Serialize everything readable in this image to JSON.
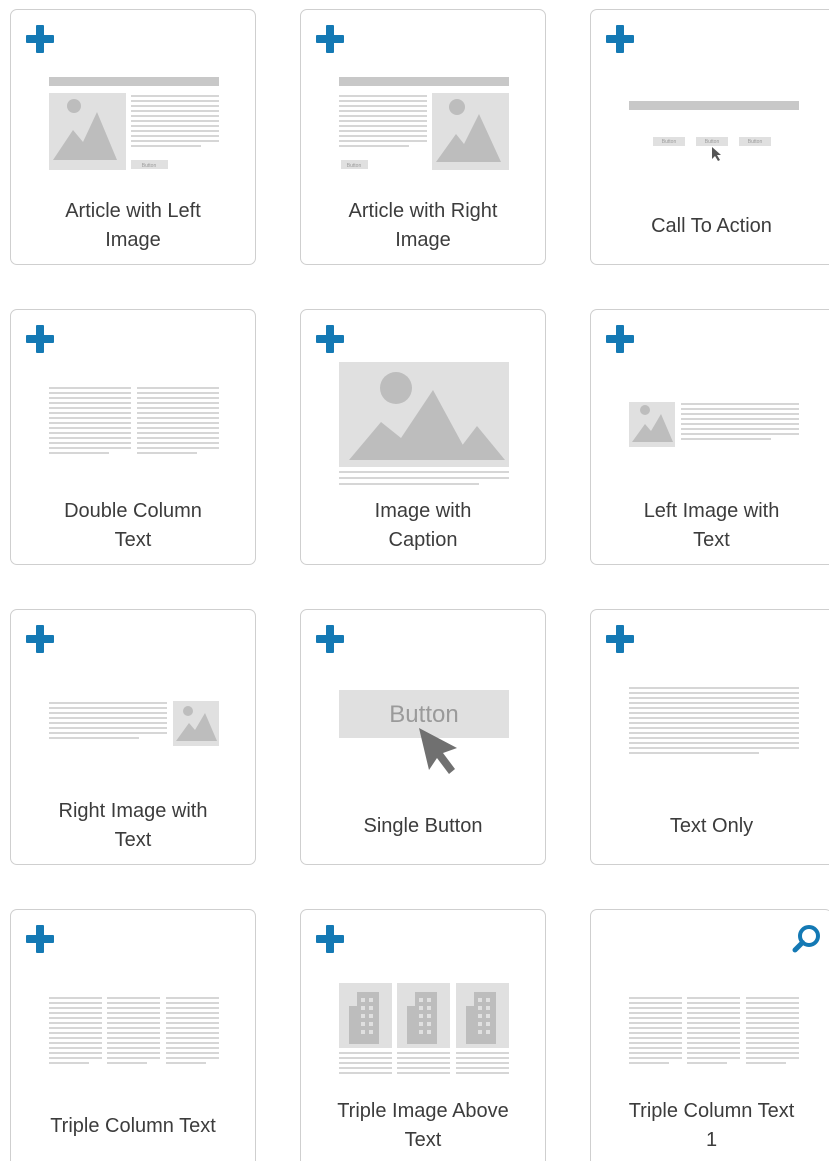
{
  "colors": {
    "accent": "#1479b4",
    "border": "#cfcfcf",
    "thumb_gray": "#c8c8c8",
    "text": "#3c3c3c"
  },
  "templates": [
    {
      "label": "Article with Left Image",
      "line1": "Article with Left",
      "line2": "Image",
      "icon": "plus-icon",
      "thumb_button": "Button"
    },
    {
      "label": "Article with Right Image",
      "line1": "Article with Right",
      "line2": "Image",
      "icon": "plus-icon",
      "thumb_button": "Button"
    },
    {
      "label": "Call To Action",
      "line1": "Call To Action",
      "line2": "",
      "icon": "plus-icon",
      "thumb_button": "Button"
    },
    {
      "label": "Double Column Text",
      "line1": "Double Column",
      "line2": "Text",
      "icon": "plus-icon"
    },
    {
      "label": "Image with Caption",
      "line1": "Image with",
      "line2": "Caption",
      "icon": "plus-icon"
    },
    {
      "label": "Left Image with Text",
      "line1": "Left Image with",
      "line2": "Text",
      "icon": "plus-icon"
    },
    {
      "label": "Right Image with Text",
      "line1": "Right Image with",
      "line2": "Text",
      "icon": "plus-icon"
    },
    {
      "label": "Single Button",
      "line1": "Single Button",
      "line2": "",
      "icon": "plus-icon",
      "thumb_button": "Button"
    },
    {
      "label": "Text Only",
      "line1": "Text Only",
      "line2": "",
      "icon": "plus-icon"
    },
    {
      "label": "Triple Column Text",
      "line1": "Triple Column Text",
      "line2": "",
      "icon": "plus-icon"
    },
    {
      "label": "Triple Image Above Text",
      "line1": "Triple Image Above",
      "line2": "Text",
      "icon": "plus-icon"
    },
    {
      "label": "Triple Column Text 1",
      "line1": "Triple Column Text",
      "line2": "1",
      "icon": "search-icon"
    }
  ]
}
